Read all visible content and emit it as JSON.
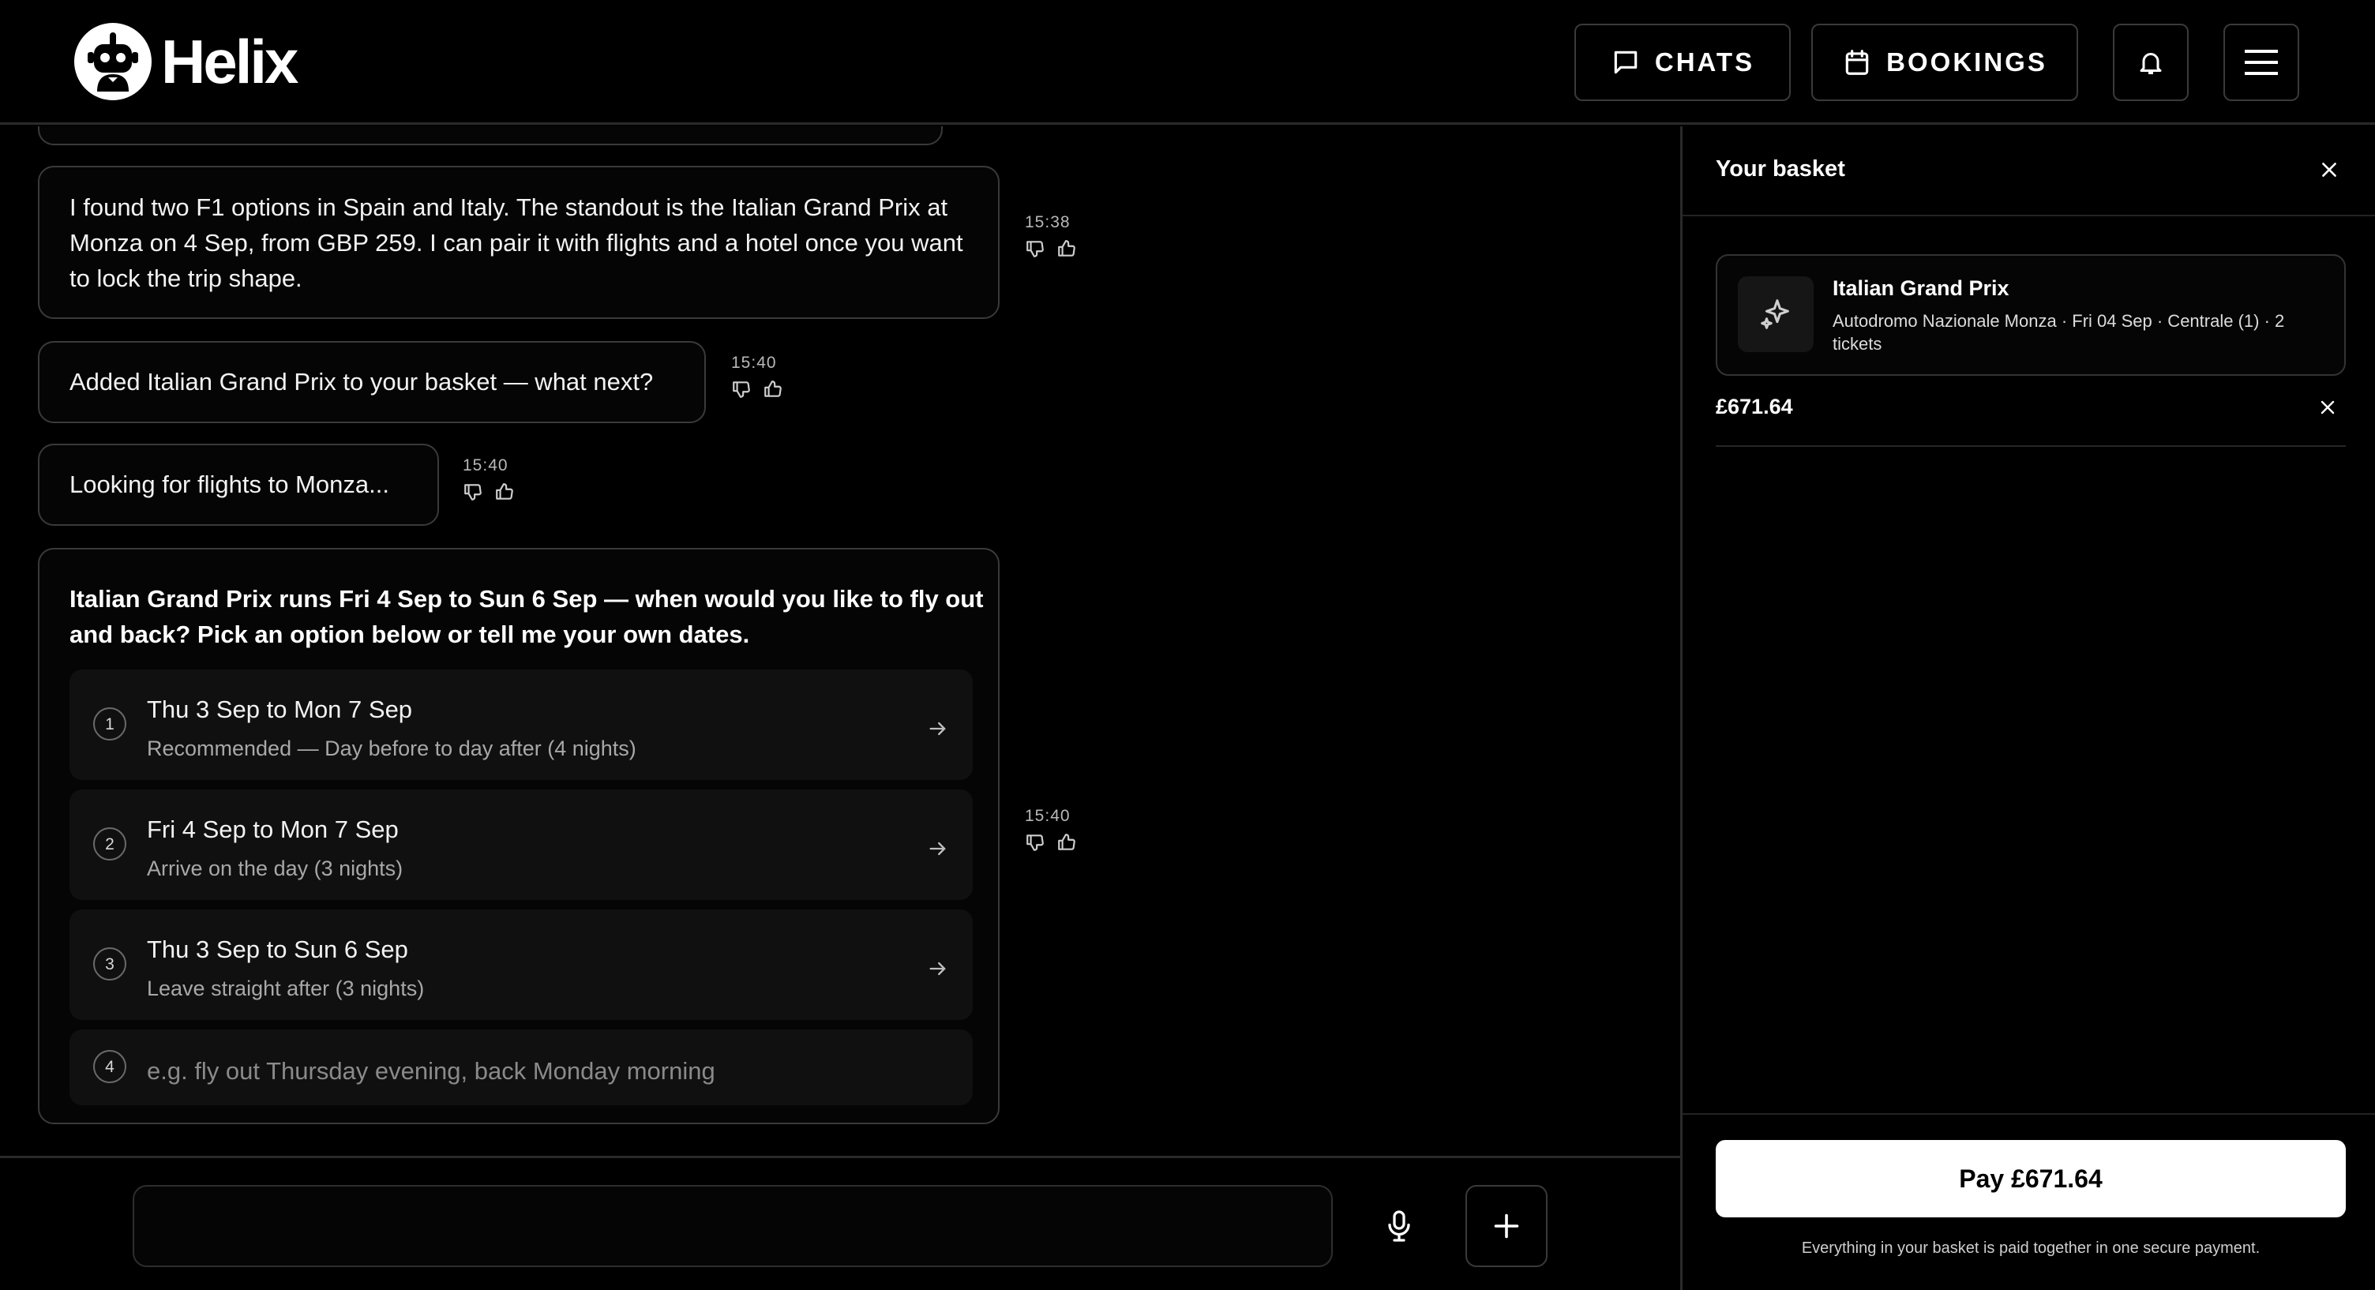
{
  "app": {
    "name": "Helix"
  },
  "header": {
    "chats_label": "CHATS",
    "bookings_label": "BOOKINGS"
  },
  "messages": [
    {
      "text": "I found two F1 options in Spain and Italy. The standout is the Italian Grand Prix at Monza on 4 Sep, from GBP 259. I can pair it with flights and a hotel once you want to lock the trip shape.",
      "time": "15:38"
    },
    {
      "text": "Added Italian Grand Prix to your basket — what next?",
      "time": "15:40"
    },
    {
      "text": "Looking for flights to Monza...",
      "time": "15:40"
    },
    {
      "question": "Italian Grand Prix runs Fri 4 Sep to Sun 6 Sep — when would you like to fly out and back? Pick an option below or tell me your own dates.",
      "time": "15:40",
      "options": [
        {
          "num": "1",
          "title": "Thu 3 Sep to Mon 7 Sep",
          "subtitle": "Recommended — Day before to day after (4 nights)"
        },
        {
          "num": "2",
          "title": "Fri 4 Sep to Mon 7 Sep",
          "subtitle": "Arrive on the day (3 nights)"
        },
        {
          "num": "3",
          "title": "Thu 3 Sep to Sun 6 Sep",
          "subtitle": "Leave straight after (3 nights)"
        }
      ],
      "custom": {
        "num": "4",
        "placeholder": "e.g. fly out Thursday evening, back Monday morning"
      }
    }
  ],
  "basket": {
    "title": "Your basket",
    "item": {
      "name": "Italian Grand Prix",
      "details": "Autodromo Nazionale Monza · Fri 04 Sep · Centrale (1) · 2 tickets",
      "price": "£671.64"
    },
    "pay_label": "Pay £671.64",
    "note": "Everything in your basket is paid together in one secure payment."
  },
  "icons": {
    "logo": "robot-logo-icon",
    "chats": "chat-bubble-icon",
    "bookings": "calendar-icon",
    "bell": "bell-icon",
    "menu": "hamburger-menu-icon",
    "thumbs_down": "thumbs-down-icon",
    "thumbs_up": "thumbs-up-icon",
    "arrow": "arrow-right-icon",
    "close": "close-icon",
    "sparkle": "sparkle-icon",
    "mic": "microphone-icon",
    "plus": "plus-icon"
  }
}
